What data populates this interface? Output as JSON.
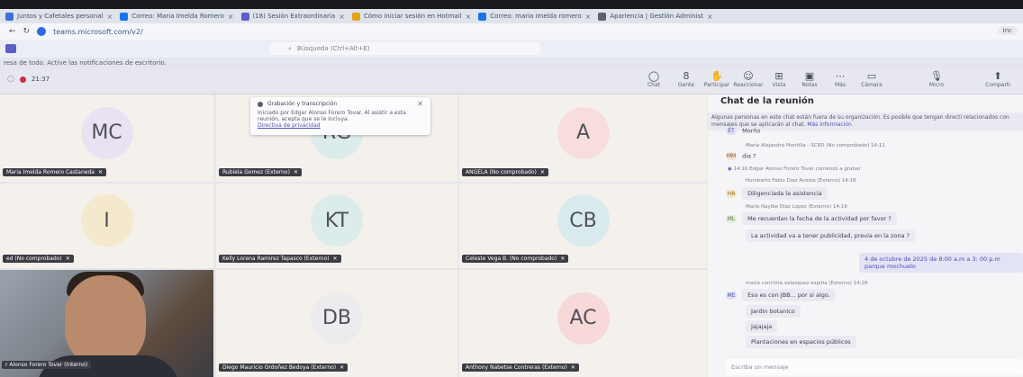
{
  "browser": {
    "tabs": [
      {
        "label": "Juntos y Cafetales personal",
        "color": "#3b6fd9"
      },
      {
        "label": "Correo: Maria Imelda Romero",
        "color": "#1a73e8"
      },
      {
        "label": "(18) Sesión Extraordinaria",
        "color": "#5b5fc7"
      },
      {
        "label": "Cómo iniciar sesión en Hotmail",
        "color": "#e3a21a"
      },
      {
        "label": "Correo: maria imelda romero",
        "color": "#1a73e8"
      },
      {
        "label": "Apariencia | Gestión Administ",
        "color": "#5f6368"
      }
    ],
    "url": "teams.microsoft.com/v2/",
    "right_button": "Inc"
  },
  "teams": {
    "search_placeholder": "Búsqueda (Ctrl+Alt+E)",
    "notification_text": "resa de todo. Active las notificaciones de escritorio.",
    "timer": "21:37"
  },
  "toolbar": {
    "buttons": [
      {
        "label": "Chat",
        "icon": "chat-icon",
        "glyph": "◯"
      },
      {
        "label": "Gente",
        "icon": "people-icon",
        "glyph": "8"
      },
      {
        "label": "Participar",
        "icon": "raise-hand-icon",
        "glyph": "✋"
      },
      {
        "label": "Reaccionar",
        "icon": "reaction-icon",
        "glyph": "☺"
      },
      {
        "label": "Vista",
        "icon": "view-icon",
        "glyph": "⊞"
      },
      {
        "label": "Notas",
        "icon": "notes-icon",
        "glyph": "▣"
      },
      {
        "label": "Más",
        "icon": "more-icon",
        "glyph": "⋯"
      },
      {
        "label": "Cámara",
        "icon": "camera-icon",
        "glyph": "▭"
      },
      {
        "label": "Micro",
        "icon": "mic-icon",
        "glyph": "🎙"
      },
      {
        "label": "Comparti",
        "icon": "share-icon",
        "glyph": "⬆"
      }
    ]
  },
  "popup": {
    "title": "Grabación y transcripción",
    "body": "Iniciado por Edgar Alonso Forero Tovar. Al asistir a esta reunión, acepta que se le incluya.",
    "link": "Directiva de privacidad"
  },
  "participants": [
    {
      "initials": "MC",
      "name": "Maria Imelda Romero Castaneda",
      "color": "#e8e2f3"
    },
    {
      "initials": "RG",
      "name": "Rubiela Gomez (Externo)",
      "color": "#dcecea"
    },
    {
      "initials": "A",
      "name": "ANGELA (No comprobado)",
      "color": "#f7dedd"
    },
    {
      "initials": "I",
      "name": "ed (No comprobado)",
      "color": "#f4e9cc"
    },
    {
      "initials": "KT",
      "name": "Kelly Lorena Ramirez Tapasco (Externo)",
      "color": "#dcecea"
    },
    {
      "initials": "CB",
      "name": "Celeste Vega B. (No comprobado)",
      "color": "#d9ebef"
    },
    {
      "initials": "",
      "name": "r Alonso Forero Tovar (Interno)",
      "color": ""
    },
    {
      "initials": "DB",
      "name": "Diego Mauricio Ordoñez Bedoya (Externo)",
      "color": "#ececee"
    },
    {
      "initials": "AC",
      "name": "Anthony Nabetse Contreras (Externo)",
      "color": "#f6d9d8"
    }
  ],
  "chat": {
    "title": "Chat de la reunión",
    "info": "Algunas personas en este chat están fuera de su organización. Es posible que tengan directi relacionados con mensajes que se aplicarán al chat.",
    "info_link": "Más información",
    "first_msg": {
      "avatar": "ET",
      "text": "Morño"
    },
    "messages": [
      {
        "meta": "Maria Alejandra Montilla - SCRD (No comprobado) 14:11",
        "avatar": "MM",
        "text": "dia ?"
      },
      {
        "meta": "14:16 Edgar Alonso Forero Tovar comenzó a grabar",
        "avatar": "",
        "text": ""
      },
      {
        "meta": "Humberto Fabio Diaz Acosta (Externo) 14:18",
        "avatar": "HA",
        "text": "Diligenciada la asistencia"
      },
      {
        "meta": "Maria Nayibe Diaz Lopez (Externo) 14:19",
        "avatar": "ML",
        "text": "Me recuerdan la fecha de la actividad por favor ?"
      }
    ],
    "continuation": "La actividad va a tener publicidad, previa en la zona ?",
    "self_msg": "4 de octubre de 2025 de 8:00 a.m a 3: 00 p.m parque mochuelo",
    "last_meta": "maria conchita velasquez espitia (Externo) 14:28",
    "last_avatar": "ME",
    "last_lines": [
      "Eso es con JBB... por si algo.",
      "Jardin botanico",
      "Jajajaja",
      "Plantaciones en espacios públicos"
    ],
    "compose_placeholder": "Escriba un mensaje"
  }
}
